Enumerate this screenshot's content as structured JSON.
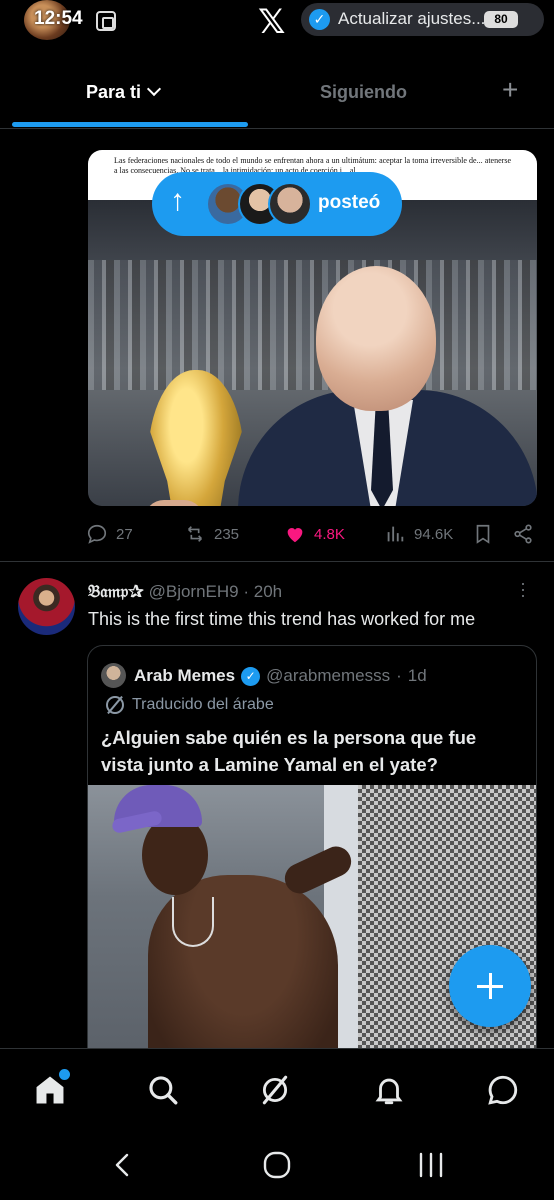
{
  "status_bar": {
    "time": "12:54",
    "notification_text": "Actualizar ajustes...",
    "battery": "80"
  },
  "tabs": [
    {
      "label": "Para ti",
      "active": true
    },
    {
      "label": "Siguiendo",
      "active": false
    }
  ],
  "post1": {
    "article_text": "Las federaciones nacionales de todo el mundo se enfrentan ahora a un ultimátum: aceptar la toma irreversible de... atenerse a las consecuencias. No se trata... la intimidación: un acto de coerción i... al.",
    "posted_pill_label": "posteó",
    "actions": {
      "replies": "27",
      "reposts": "235",
      "likes": "4.8K",
      "views": "94.6K"
    }
  },
  "post2": {
    "author_name": "𝔅𝔞𝔪𝔭✰",
    "handle": "@BjornEH9",
    "time": "20h",
    "text": "This is the first time this trend has worked for me",
    "quote": {
      "author_name": "Arab Memes",
      "handle": "@arabmemesss",
      "time": "1d",
      "translated_label": "Traducido del árabe",
      "text": "¿Alguien sabe quién es la persona que fue vista junto a Lamine Yamal en el yate?"
    }
  },
  "colors": {
    "accent": "#1d9bf0",
    "like": "#f91880",
    "muted": "#71767b",
    "text": "#e7e9ea",
    "background": "#000000"
  },
  "icons": {
    "nav": [
      "home-icon",
      "search-icon",
      "grok-icon",
      "bell-icon",
      "messages-icon"
    ],
    "system": [
      "back-icon",
      "home-circle-icon",
      "recents-icon"
    ]
  }
}
